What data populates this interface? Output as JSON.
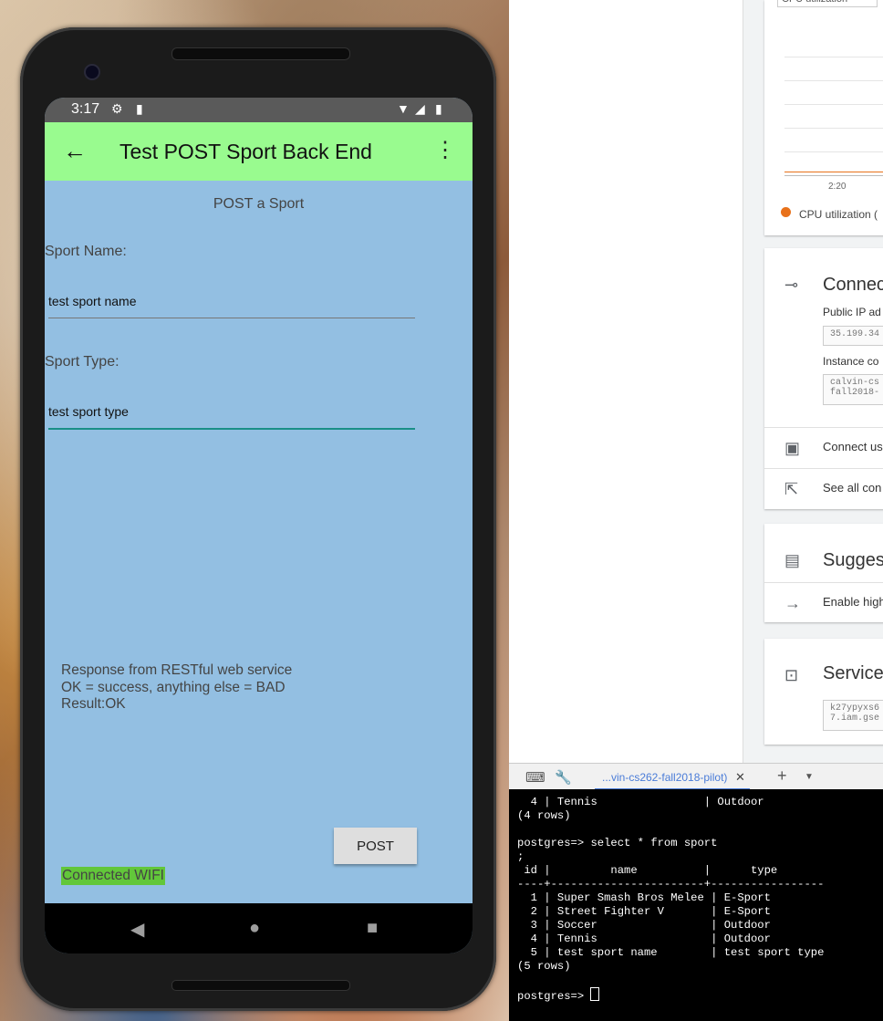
{
  "phone": {
    "status_time": "3:17",
    "app_title": "Test POST Sport Back End",
    "heading": "POST a Sport",
    "sport_name_label": "Sport Name:",
    "sport_name_value": "test sport name",
    "sport_type_label": "Sport Type:",
    "sport_type_value": "test sport type",
    "response_lines": [
      "Response from RESTful web service",
      "OK = success, anything else = BAD",
      "Result:OK"
    ],
    "post_label": "POST",
    "wifi_status": "Connected WIFI",
    "accent_color": "#99fb8f"
  },
  "console": {
    "dropdown_label": "CPU utilization",
    "chart_tick": "2:20",
    "legend": "CPU utilization (",
    "connect": {
      "title": "Connec",
      "public_ip_label": "Public IP ad",
      "public_ip_value": "35.199.34",
      "instance_label": "Instance co",
      "instance_value": "calvin-cs\nfall2018-",
      "connect_using": "Connect us",
      "see_all": "See all con"
    },
    "suggest": {
      "title": "Sugges",
      "item": "Enable high"
    },
    "service": {
      "title": "Service",
      "value": "k27ypyxs6\n7.iam.gse"
    }
  },
  "terminal": {
    "tab_label": "...vin-cs262-fall2018-pilot)",
    "lines": [
      "  4 | Tennis                | Outdoor",
      "(4 rows)",
      "",
      "postgres=> select * from sport",
      ";",
      " id |         name          |      type",
      "----+-----------------------+-----------------",
      "  1 | Super Smash Bros Melee | E-Sport",
      "  2 | Street Fighter V       | E-Sport",
      "  3 | Soccer                 | Outdoor",
      "  4 | Tennis                 | Outdoor",
      "  5 | test sport name        | test sport type",
      "(5 rows)",
      ""
    ],
    "prompt": "postgres=> "
  }
}
